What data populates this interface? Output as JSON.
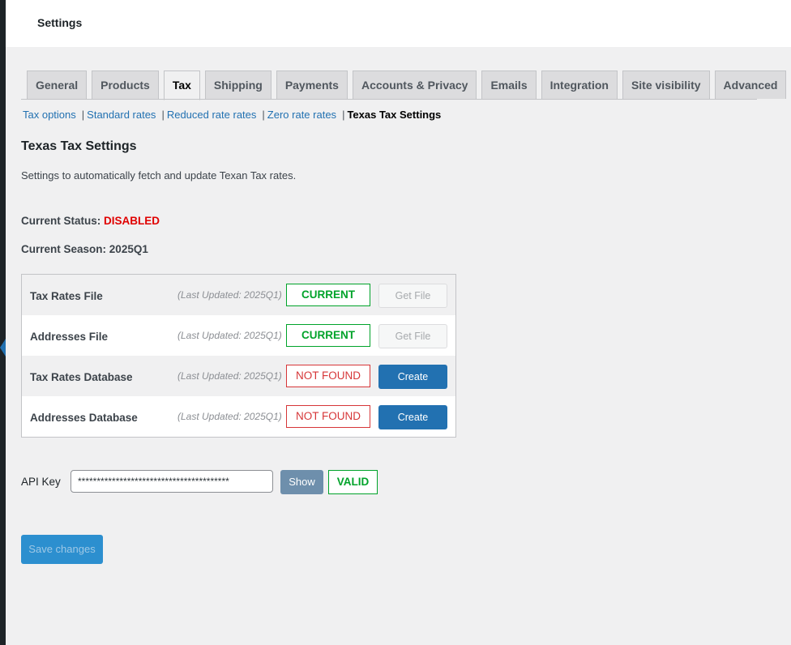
{
  "topbar": {
    "title": "Settings"
  },
  "tabs": [
    {
      "label": "General",
      "active": false
    },
    {
      "label": "Products",
      "active": false
    },
    {
      "label": "Tax",
      "active": true
    },
    {
      "label": "Shipping",
      "active": false
    },
    {
      "label": "Payments",
      "active": false
    },
    {
      "label": "Accounts & Privacy",
      "active": false
    },
    {
      "label": "Emails",
      "active": false
    },
    {
      "label": "Integration",
      "active": false
    },
    {
      "label": "Site visibility",
      "active": false
    },
    {
      "label": "Advanced",
      "active": false
    }
  ],
  "subnav": {
    "items": [
      "Tax options",
      "Standard rates",
      "Reduced rate rates",
      "Zero rate rates"
    ],
    "current": "Texas Tax Settings",
    "separator": "|"
  },
  "section": {
    "title": "Texas Tax Settings",
    "description": "Settings to automatically fetch and update Texan Tax rates."
  },
  "status": {
    "label": "Current Status:",
    "value": "DISABLED",
    "value_color": "#e00000"
  },
  "season": {
    "label": "Current Season:",
    "value": "2025Q1"
  },
  "files": [
    {
      "label": "Tax Rates File",
      "updated": "(Last Updated: 2025Q1)",
      "state": "CURRENT",
      "action": "Get File"
    },
    {
      "label": "Addresses File",
      "updated": "(Last Updated: 2025Q1)",
      "state": "CURRENT",
      "action": "Get File"
    },
    {
      "label": "Tax Rates Database",
      "updated": "(Last Updated: 2025Q1)",
      "state": "NOT FOUND",
      "action": "Create"
    },
    {
      "label": "Addresses Database",
      "updated": "(Last Updated: 2025Q1)",
      "state": "NOT FOUND",
      "action": "Create"
    }
  ],
  "api": {
    "label": "API Key",
    "value": "****************************************",
    "show_label": "Show",
    "validity": "VALID"
  },
  "save": {
    "label": "Save changes"
  },
  "colors": {
    "accent": "#2271b1",
    "ok": "#00a32a",
    "error": "#d63638",
    "background": "#f0f0f1"
  }
}
